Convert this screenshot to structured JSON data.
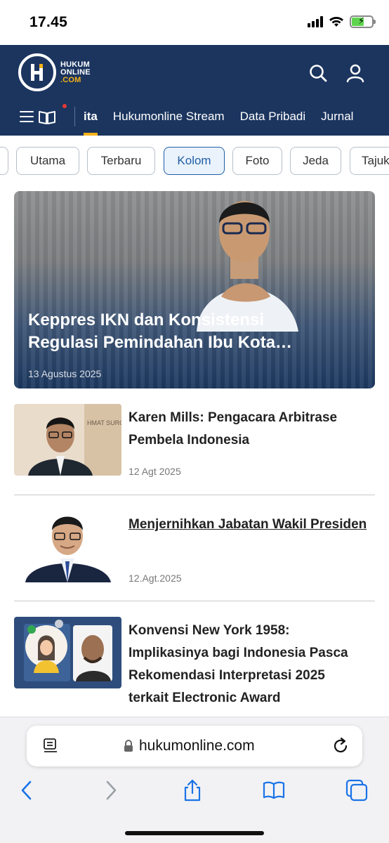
{
  "status_bar": {
    "time": "17.45"
  },
  "header": {
    "logo": {
      "line1": "HUKUM",
      "line2": "ONLINE",
      "line3": ".COM"
    },
    "nav_items": [
      "ita",
      "Hukumonline Stream",
      "Data Pribadi",
      "Jurnal"
    ]
  },
  "categories": [
    "Utama",
    "Terbaru",
    "Kolom",
    "Foto",
    "Jeda",
    "Tajuk"
  ],
  "active_category": "Kolom",
  "hero": {
    "title": "Keppres IKN dan Konsistensi Regulasi Pemindahan Ibu Kota…",
    "date": "13 Agustus 2025"
  },
  "articles": [
    {
      "title": "Karen Mills: Pengacara Arbitrase Pembela Indonesia",
      "date": "12 Agt 2025"
    },
    {
      "title": "Menjernihkan Jabatan Wakil Presiden",
      "date": "12.Agt.2025"
    },
    {
      "title": "Konvensi New York 1958: Implikasinya bagi Indonesia Pasca Rekomendasi Interpretasi 2025 terkait Electronic Award",
      "date": ""
    }
  ],
  "browser": {
    "url": "hukumonline.com"
  },
  "colors": {
    "header_bg": "#1b355f",
    "accent": "#f5b21a",
    "active_chip": "#1f5ea6"
  }
}
